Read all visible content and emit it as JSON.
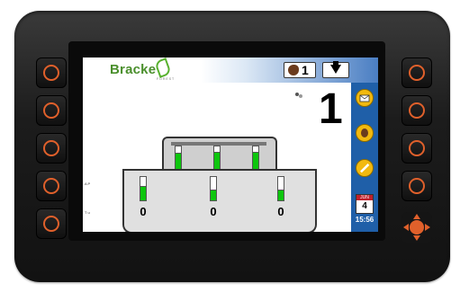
{
  "brand": {
    "name": "Bracke",
    "subtitle": "FOREST"
  },
  "header": {
    "operator_count": "1"
  },
  "status": {
    "big_number": "1"
  },
  "sidebar": {
    "calendar_month": "JUN",
    "calendar_day": "4",
    "time": "15:56"
  },
  "machine": {
    "values": [
      "0",
      "0",
      "0"
    ],
    "side_labels": [
      "A P",
      "T u"
    ],
    "top_levels": [
      0.7,
      0.75,
      0.75
    ],
    "bottom_levels": [
      0.6,
      0.45,
      0.45
    ]
  },
  "colors": {
    "accent": "#4a7ec3",
    "knob_ring": "#e0602b",
    "level_fill": "#0dc60d"
  }
}
